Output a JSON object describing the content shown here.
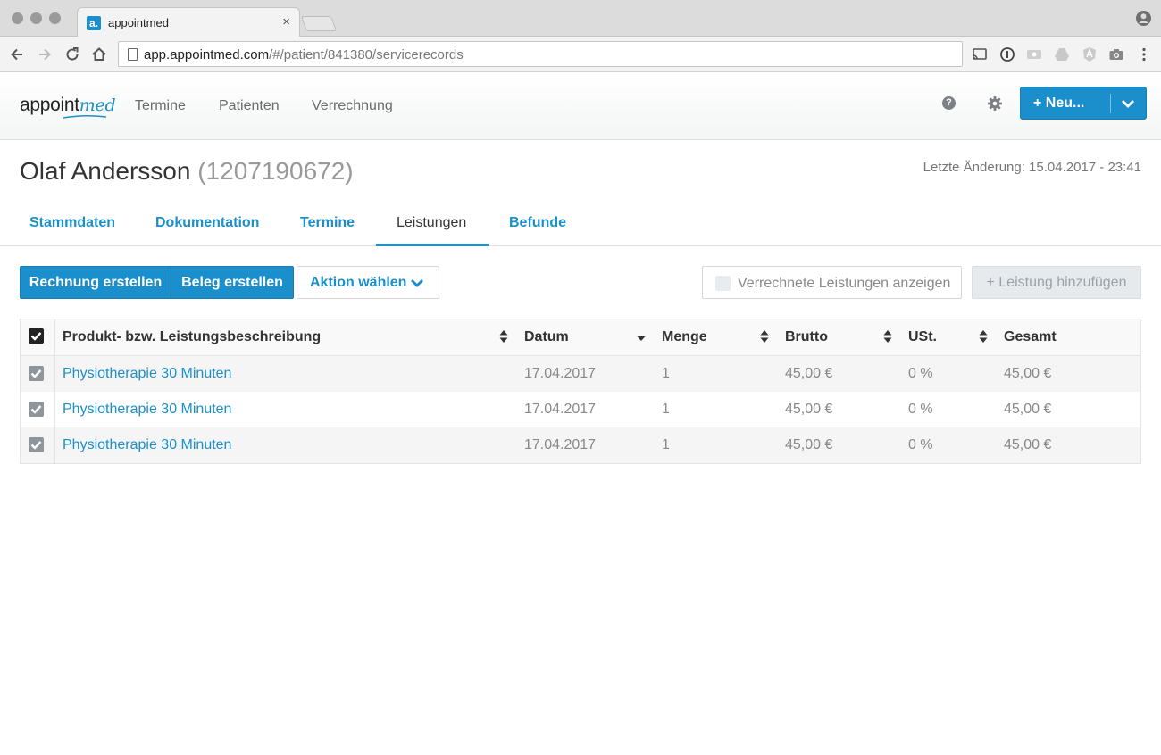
{
  "browser": {
    "tab_title": "appointmed",
    "favicon_letter": "a.",
    "tab_close": "×",
    "url_host": "app.appointmed.com",
    "url_path": "/#/patient/841380/servicerecords"
  },
  "app": {
    "logo_main": "appoint",
    "logo_accent": "med",
    "nav": [
      "Termine",
      "Patienten",
      "Verrechnung"
    ],
    "help_glyph": "?",
    "new_button": "+ Neu...",
    "brand_color": "#1b8fcb"
  },
  "patient": {
    "name": "Olaf Andersson",
    "id": "(1207190672)",
    "last_change": "Letzte Änderung: 15.04.2017 - 23:41"
  },
  "tabs": [
    "Stammdaten",
    "Dokumentation",
    "Termine",
    "Leistungen",
    "Befunde"
  ],
  "active_tab": "Leistungen",
  "actions": {
    "invoice": "Rechnung erstellen",
    "receipt": "Beleg erstellen",
    "choose_action": "Aktion wählen",
    "show_billed": "Verrechnete Leistungen anzeigen",
    "add_service": "+ Leistung hinzufügen"
  },
  "table": {
    "columns": [
      "Produkt- bzw. Leistungsbeschreibung",
      "Datum",
      "Menge",
      "Brutto",
      "USt.",
      "Gesamt"
    ],
    "rows": [
      {
        "description": "Physiotherapie 30 Minuten",
        "date": "17.04.2017",
        "quantity": "1",
        "gross": "45,00 €",
        "vat": "0 %",
        "total": "45,00 €",
        "checked": true
      },
      {
        "description": "Physiotherapie 30 Minuten",
        "date": "17.04.2017",
        "quantity": "1",
        "gross": "45,00 €",
        "vat": "0 %",
        "total": "45,00 €",
        "checked": true
      },
      {
        "description": "Physiotherapie 30 Minuten",
        "date": "17.04.2017",
        "quantity": "1",
        "gross": "45,00 €",
        "vat": "0 %",
        "total": "45,00 €",
        "checked": true
      }
    ]
  }
}
